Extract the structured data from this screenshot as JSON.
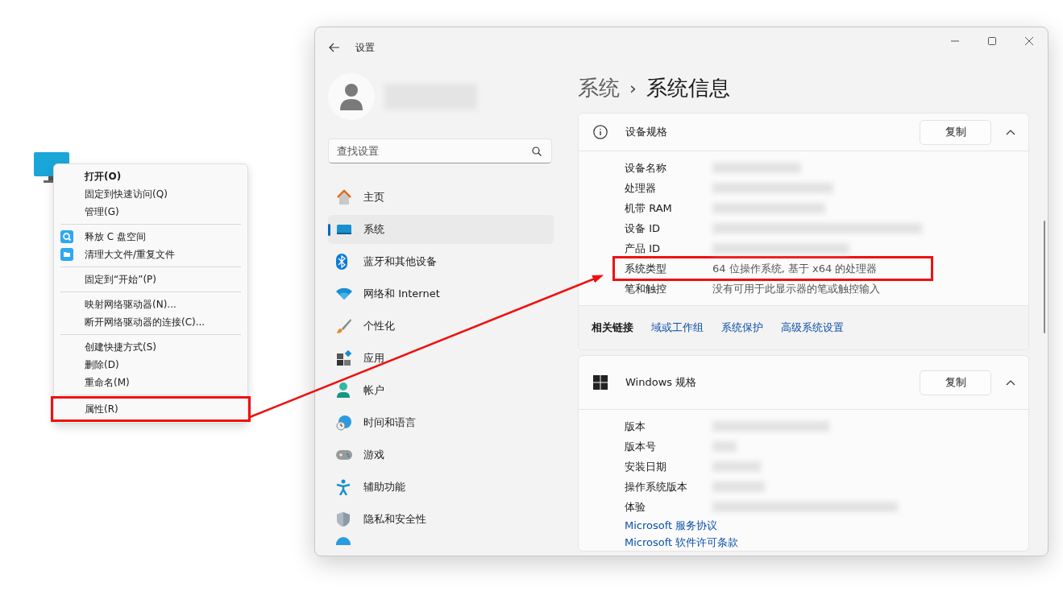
{
  "context_menu": {
    "items": [
      {
        "kind": "item",
        "label": "打开(O)",
        "default": true,
        "highlighted": false
      },
      {
        "kind": "item",
        "label": "固定到快速访问(Q)",
        "default": false,
        "highlighted": false
      },
      {
        "kind": "item",
        "label": "管理(G)",
        "default": false,
        "highlighted": false
      },
      {
        "kind": "separator"
      },
      {
        "kind": "search",
        "label": "释放 C 盘空间",
        "default": false,
        "highlighted": false
      },
      {
        "kind": "folder",
        "label": "清理大文件/重复文件",
        "default": false,
        "highlighted": false
      },
      {
        "kind": "separator"
      },
      {
        "kind": "item",
        "label": "固定到“开始”(P)",
        "default": false,
        "highlighted": false
      },
      {
        "kind": "separator"
      },
      {
        "kind": "item",
        "label": "映射网络驱动器(N)...",
        "default": false,
        "highlighted": false
      },
      {
        "kind": "item",
        "label": "断开网络驱动器的连接(C)...",
        "default": false,
        "highlighted": false
      },
      {
        "kind": "separator"
      },
      {
        "kind": "item",
        "label": "创建快捷方式(S)",
        "default": false,
        "highlighted": false
      },
      {
        "kind": "item",
        "label": "删除(D)",
        "default": false,
        "highlighted": false
      },
      {
        "kind": "item",
        "label": "重命名(M)",
        "default": false,
        "highlighted": false
      },
      {
        "kind": "separator"
      },
      {
        "kind": "item",
        "label": "属性(R)",
        "default": false,
        "highlighted": true
      }
    ]
  },
  "window": {
    "title": "设置"
  },
  "search": {
    "placeholder": "查找设置"
  },
  "nav": [
    {
      "label": "主页",
      "kind": "home",
      "selected": false
    },
    {
      "label": "系统",
      "kind": "system",
      "selected": true
    },
    {
      "label": "蓝牙和其他设备",
      "kind": "bluetooth",
      "selected": false
    },
    {
      "label": "网络和 Internet",
      "kind": "wifi",
      "selected": false
    },
    {
      "label": "个性化",
      "kind": "brush",
      "selected": false
    },
    {
      "label": "应用",
      "kind": "apps",
      "selected": false
    },
    {
      "label": "帐户",
      "kind": "account",
      "selected": false
    },
    {
      "label": "时间和语言",
      "kind": "time",
      "selected": false
    },
    {
      "label": "游戏",
      "kind": "game",
      "selected": false
    },
    {
      "label": "辅助功能",
      "kind": "access",
      "selected": false
    },
    {
      "label": "隐私和安全性",
      "kind": "shield",
      "selected": false
    }
  ],
  "breadcrumb": {
    "parent": "系统",
    "separator": "›",
    "current": "系统信息"
  },
  "sections": [
    {
      "title": "设备规格",
      "kind": "info",
      "button": "复制",
      "expanded": true,
      "rows": [
        {
          "label": "设备名称",
          "blurred": true,
          "highlighted": false
        },
        {
          "label": "处理器",
          "blurred": true,
          "highlighted": false
        },
        {
          "label": "机带 RAM",
          "blurred": true,
          "highlighted": false
        },
        {
          "label": "设备 ID",
          "blurred": true,
          "highlighted": false
        },
        {
          "label": "产品 ID",
          "blurred": true,
          "highlighted": false
        },
        {
          "label": "系统类型",
          "value": "64 位操作系统, 基于 x64 的处理器",
          "blurred": false,
          "highlighted": true
        },
        {
          "label": "笔和触控",
          "value": "没有可用于此显示器的笔或触控输入",
          "blurred": false,
          "highlighted": false
        }
      ],
      "related": {
        "label": "相关链接",
        "links": [
          "域或工作组",
          "系统保护",
          "高级系统设置"
        ]
      }
    },
    {
      "title": "Windows 规格",
      "kind": "windows",
      "button": "复制",
      "expanded": true,
      "rows": [
        {
          "label": "版本",
          "blurred": true,
          "highlighted": false
        },
        {
          "label": "版本号",
          "blurred": true,
          "highlighted": false
        },
        {
          "label": "安装日期",
          "blurred": true,
          "highlighted": false
        },
        {
          "label": "操作系统版本",
          "blurred": true,
          "highlighted": false
        },
        {
          "label": "体验",
          "blurred": true,
          "highlighted": false
        }
      ],
      "links": [
        "Microsoft 服务协议",
        "Microsoft 软件许可条款"
      ]
    }
  ]
}
